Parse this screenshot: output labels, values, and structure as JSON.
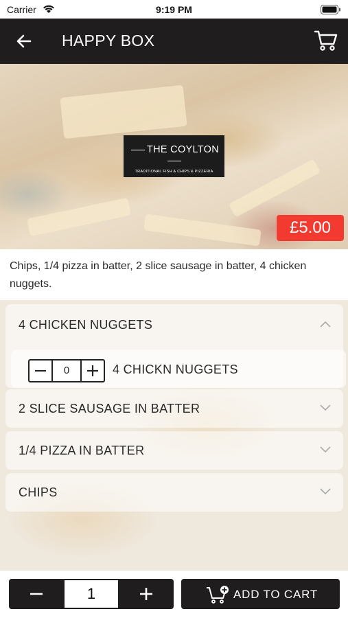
{
  "status_bar": {
    "carrier": "Carrier",
    "time": "9:19 PM"
  },
  "header": {
    "title": "HAPPY BOX",
    "back_icon": "arrow-left-icon",
    "cart_icon": "cart-icon"
  },
  "hero": {
    "logo_name": "THE COYLTON",
    "logo_tagline": "TRADITIONAL FISH & CHIPS & PIZZERIA",
    "price": "£5.00",
    "price_color": "#f23a30"
  },
  "description": "Chips, 1/4 pizza in batter, 2 slice sausage in batter, 4 chicken nuggets.",
  "options": [
    {
      "title": "4 CHICKEN NUGGETS",
      "expanded": true,
      "items": [
        {
          "label": "4 CHICKN NUGGETS",
          "quantity": "0"
        }
      ]
    },
    {
      "title": "2 SLICE SAUSAGE IN BATTER",
      "expanded": false
    },
    {
      "title": "1/4 PIZZA IN BATTER",
      "expanded": false
    },
    {
      "title": "CHIPS",
      "expanded": false
    }
  ],
  "footer": {
    "quantity": "1",
    "add_to_cart_label": "ADD TO CART",
    "add_icon": "cart-plus-icon",
    "bar_color": "#1f1d1d"
  }
}
